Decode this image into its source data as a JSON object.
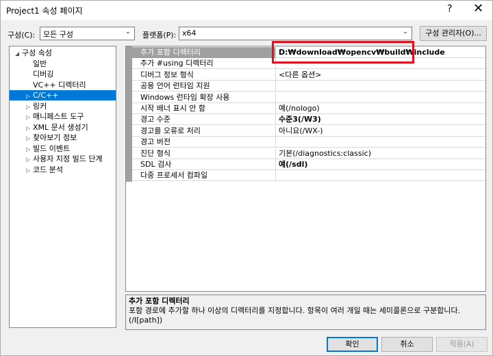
{
  "window": {
    "title": "Project1 속성 페이지",
    "help": "?",
    "close": "✕"
  },
  "toolbar": {
    "config_label": "구성(C):",
    "config_value": "모든 구성",
    "platform_label": "플랫폼(P):",
    "platform_value": "x64",
    "config_manager": "구성 관리자(O)..."
  },
  "tree": [
    {
      "label": "구성 속성",
      "toggle": "◢",
      "indent": 0
    },
    {
      "label": "일반",
      "toggle": "",
      "indent": 1
    },
    {
      "label": "디버깅",
      "toggle": "",
      "indent": 1
    },
    {
      "label": "VC++ 디렉터리",
      "toggle": "",
      "indent": 1
    },
    {
      "label": "C/C++",
      "toggle": "▷",
      "indent": 1,
      "selected": true
    },
    {
      "label": "링커",
      "toggle": "▷",
      "indent": 1
    },
    {
      "label": "매니페스트 도구",
      "toggle": "▷",
      "indent": 1
    },
    {
      "label": "XML 문서 생성기",
      "toggle": "▷",
      "indent": 1
    },
    {
      "label": "찾아보기 정보",
      "toggle": "▷",
      "indent": 1
    },
    {
      "label": "빌드 이벤트",
      "toggle": "▷",
      "indent": 1
    },
    {
      "label": "사용자 지정 빌드 단계",
      "toggle": "▷",
      "indent": 1
    },
    {
      "label": "코드 분석",
      "toggle": "▷",
      "indent": 1
    }
  ],
  "properties": [
    {
      "name": "추가 포함 디렉터리",
      "value": "D:₩download₩opencv₩build₩include",
      "bold": true,
      "selected": true
    },
    {
      "name": "추가 #using 디렉터리",
      "value": ""
    },
    {
      "name": "디버그 정보 형식",
      "value": "<다른 옵션>"
    },
    {
      "name": "공용 언어 런타임 지원",
      "value": ""
    },
    {
      "name": "Windows 런타임 확장 사용",
      "value": ""
    },
    {
      "name": "시작 배너 표시 안 함",
      "value": "예(/nologo)"
    },
    {
      "name": "경고 수준",
      "value": "수준3(/W3)",
      "bold": true
    },
    {
      "name": "경고를 오류로 처리",
      "value": "아니요(/WX-)"
    },
    {
      "name": "경고 버전",
      "value": ""
    },
    {
      "name": "진단 형식",
      "value": "기본(/diagnostics:classic)"
    },
    {
      "name": "SDL 검사",
      "value": "예(/sdl)",
      "bold": true
    },
    {
      "name": "다중 프로세서 컴파일",
      "value": ""
    }
  ],
  "description": {
    "title": "추가 포함 디렉터리",
    "text": "포함 경로에 추가할 하나 이상의 디렉터리를 지정합니다. 항목이 여러 개일 때는 세미콜론으로 구분합니다.",
    "switch": "(/I[path])"
  },
  "buttons": {
    "ok": "확인",
    "cancel": "취소",
    "apply": "적용(A)"
  },
  "colors": {
    "selection": "#0078d7",
    "annotation": "#e0101e"
  }
}
